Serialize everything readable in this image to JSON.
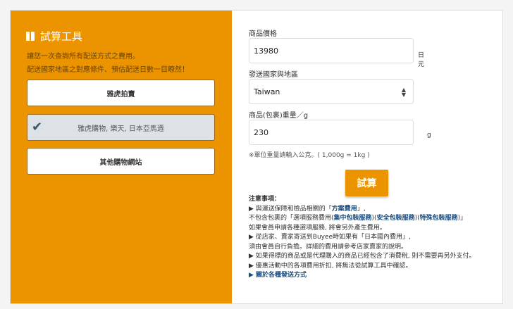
{
  "left": {
    "title": "試算工具",
    "desc1": "讓您一次查詢所有配送方式之費用。",
    "desc2": "配送國家地區之對應條件、預估配送日數一目瞭然！",
    "options": [
      "雅虎拍賣",
      "雅虎購物, 樂天, 日本亞馬遜",
      "其他購物網站"
    ]
  },
  "form": {
    "price_label": "商品價格",
    "price_value": "13980",
    "price_unit": "日元",
    "country_label": "發送國家與地區",
    "country_value": "Taiwan",
    "weight_label": "商品(包裹)重量／g",
    "weight_value": "230",
    "weight_unit": "g",
    "weight_hint": "※單位重量請輸入公克。( 1,000g = 1kg )",
    "submit": "試算"
  },
  "notes": {
    "heading": "注意事項：",
    "l1a": "▶ 與運送保障和檢品相關的「",
    "l1link": "方案費用",
    "l1b": "」,",
    "l2a": "不包含包裹的「選項服務費用(",
    "l2link1": "集中包裝服務",
    "l2s1": ")(",
    "l2link2": "安全包裝服務",
    "l2s2": ")(",
    "l2link3": "特殊包裝服務",
    "l2b": ")」",
    "l3": "如果會員申請各種選項服務, 將會另外產生費用。",
    "l4": "▶ 從店家、賣家寄送到Buyee時如果有「日本國內費用」,",
    "l5": "須由會員自行負擔。詳細的費用請參考店家賣家的說明。",
    "l6": "▶ 如果得標的商品或是代理購入的商品已經包含了消費稅, 則不需要再另外支付。",
    "l7": "▶ 優惠活動中的各項費用折扣, 將無法從試算工具中確認。",
    "l8": "▶ 關於各種發送方式"
  }
}
